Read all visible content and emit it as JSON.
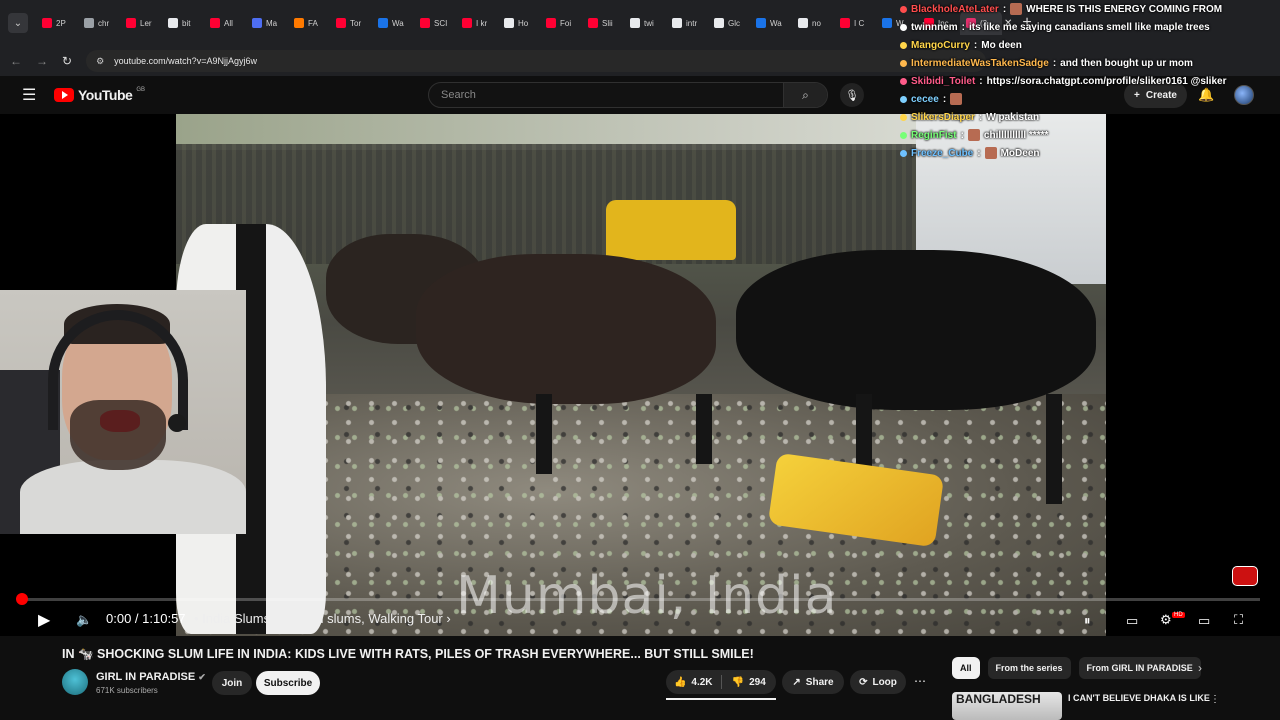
{
  "browser": {
    "tabs": [
      {
        "label": "2P",
        "color": "#ff0033"
      },
      {
        "label": "chr",
        "color": "#9aa0a6"
      },
      {
        "label": "Ler",
        "color": "#ff0033"
      },
      {
        "label": "bit",
        "color": "#e8eaed"
      },
      {
        "label": "All",
        "color": "#ff0033"
      },
      {
        "label": "Ma",
        "color": "#4e6ef2"
      },
      {
        "label": "FA",
        "color": "#ff7a00"
      },
      {
        "label": "Tor",
        "color": "#ff0033"
      },
      {
        "label": "Wa",
        "color": "#1a73e8"
      },
      {
        "label": "SCI",
        "color": "#ff0033"
      },
      {
        "label": "I kr",
        "color": "#ff0033"
      },
      {
        "label": "Ho",
        "color": "#e8eaed"
      },
      {
        "label": "Foi",
        "color": "#ff0033"
      },
      {
        "label": "Slii",
        "color": "#ff0033"
      },
      {
        "label": "twi",
        "color": "#e8eaed"
      },
      {
        "label": "intr",
        "color": "#e8eaed"
      },
      {
        "label": "Glc",
        "color": "#e8eaed"
      },
      {
        "label": "Wa",
        "color": "#1a73e8"
      },
      {
        "label": "no",
        "color": "#e8eaed"
      },
      {
        "label": "I C",
        "color": "#ff0033"
      },
      {
        "label": "W",
        "color": "#1a73e8"
      },
      {
        "label": "Inc",
        "color": "#ff0033"
      },
      {
        "label": "(3",
        "color": "#e1306c"
      }
    ],
    "url": "youtube.com/watch?v=A9NjjAgyj6w"
  },
  "youtube": {
    "logo_text": "YouTube",
    "logo_country": "GB",
    "search_placeholder": "Search",
    "create_label": "Create"
  },
  "stream_chat": [
    {
      "user": "BlackholeAteLater",
      "message": "WHERE IS THIS ENERGY COMING FROM",
      "color": "#ff4d4d",
      "emote": true
    },
    {
      "user": "twinnnem",
      "message": "its like me saying canadians smell like maple trees",
      "color": "#ffffff",
      "emote": false
    },
    {
      "user": "MangoCurry",
      "message": "Mo deen",
      "color": "#ffd54a",
      "emote": false
    },
    {
      "user": "IntermediateWasTakenSadge",
      "message": "and then bought up ur mom",
      "color": "#ffb84d",
      "emote": false
    },
    {
      "user": "Skibidi_Toilet",
      "message": "https://sora.chatgpt.com/profile/sliker0161 @sliker",
      "color": "#ff5c8a",
      "emote": false
    },
    {
      "user": "cecee",
      "message": "",
      "color": "#7fd0ff",
      "emote": true
    },
    {
      "user": "SlikersDiaper",
      "message": "W pakistan",
      "color": "#ffd54a",
      "emote": false
    },
    {
      "user": "ReginFist",
      "message": "chillllllllll *****",
      "color": "#77ff77",
      "emote": true
    },
    {
      "user": "Freeze_Cube",
      "message": "MoDeen",
      "color": "#6ec1ff",
      "emote": true
    }
  ],
  "video": {
    "overlay_text": "Mumbai, India",
    "time_current": "0:00",
    "time_total": "1:10:57",
    "chapter": "India Slums, Mumbai slums, Walking Tour",
    "progress": 0.0
  },
  "details": {
    "title_prefix": "IN 🐄",
    "title": "SHOCKING SLUM LIFE IN INDIA: KIDS LIVE WITH RATS, PILES OF TRASH EVERYWHERE... BUT STILL SMILE!",
    "channel_name": "GIRL IN PARADISE",
    "subscribers": "671K subscribers",
    "join_label": "Join",
    "subscribe_label": "Subscribe",
    "likes": "4.2K",
    "dislikes": "294",
    "share_label": "Share",
    "loop_label": "Loop"
  },
  "recommendations": {
    "chips": [
      "All",
      "From the series",
      "From GIRL IN PARADISE"
    ],
    "first_thumb_text": "BANGLADESH",
    "first_title": "I CAN'T BELIEVE DHAKA IS LIKE"
  },
  "colors": {
    "accent": "#ff0000",
    "background": "#0f0f0f"
  }
}
